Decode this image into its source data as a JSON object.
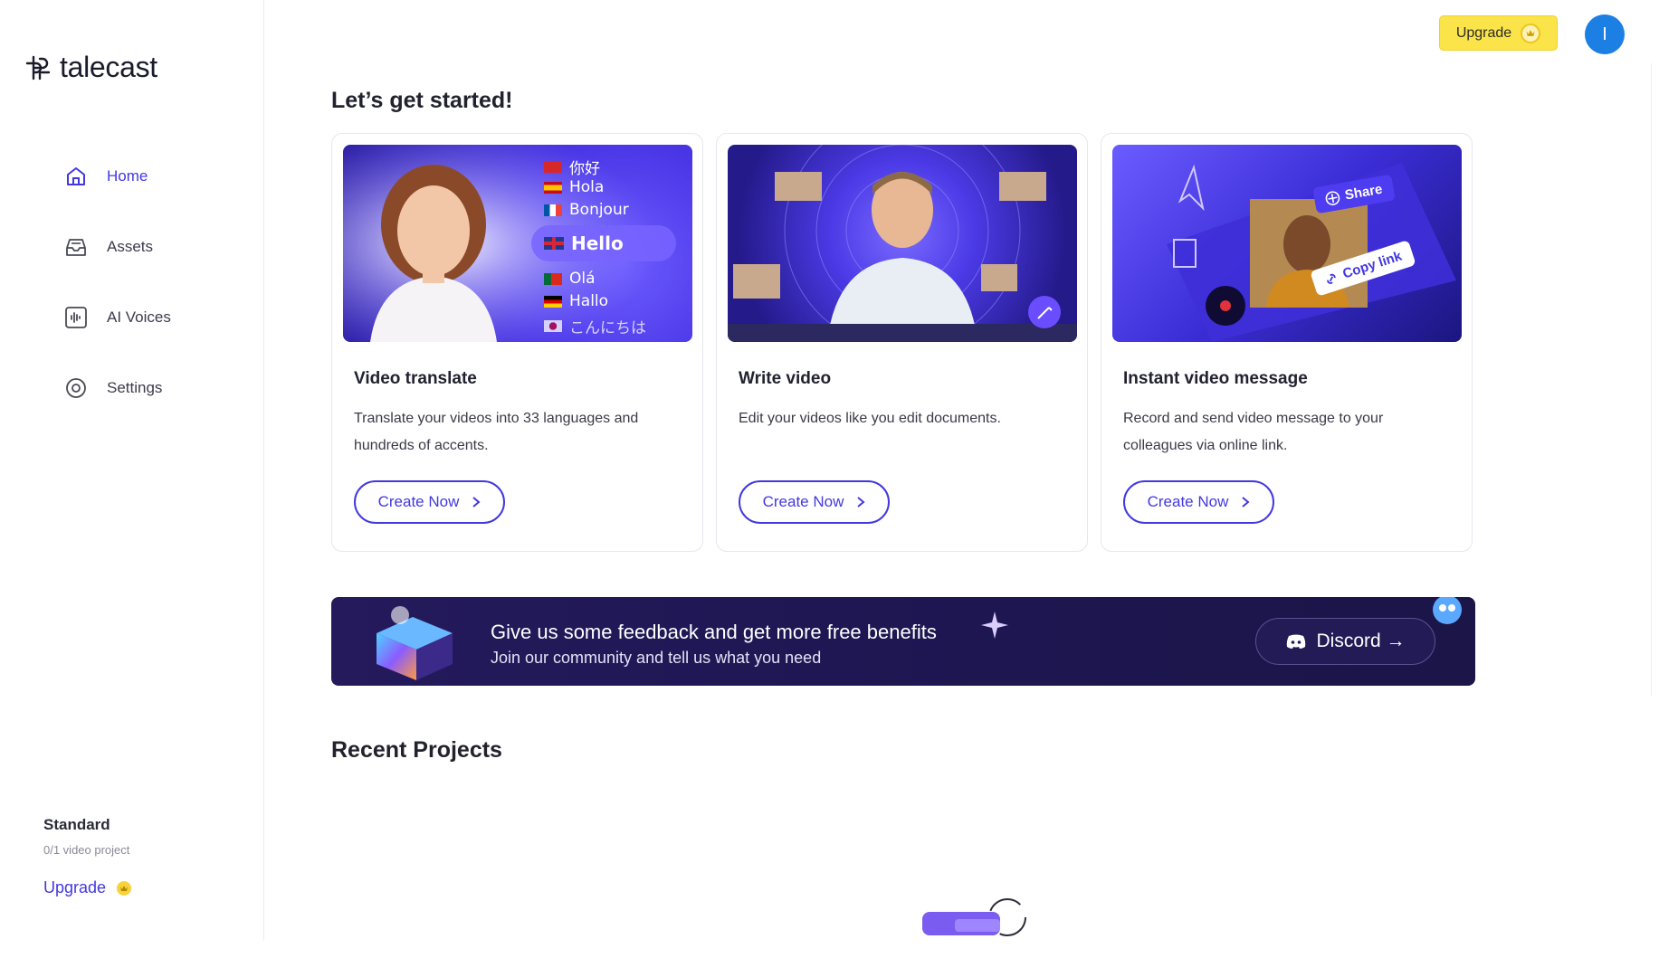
{
  "app": {
    "name": "talecast"
  },
  "sidebar": {
    "items": [
      {
        "label": "Home",
        "icon": "home-icon",
        "active": true
      },
      {
        "label": "Assets",
        "icon": "assets-icon",
        "active": false
      },
      {
        "label": "AI Voices",
        "icon": "waveform-icon",
        "active": false
      },
      {
        "label": "Settings",
        "icon": "gear-icon",
        "active": false
      }
    ],
    "plan": {
      "name": "Standard",
      "usage": "0/1 video project",
      "upgrade_label": "Upgrade"
    }
  },
  "header": {
    "upgrade_label": "Upgrade",
    "avatar_initial": "I"
  },
  "main": {
    "get_started_title": "Let’s get started!",
    "cards": [
      {
        "title": "Video translate",
        "desc": "Translate your videos into 33 languages and hundreds of accents.",
        "button": "Create Now",
        "languages": [
          "你好",
          "Hola",
          "Bonjour",
          "Hello",
          "Olá",
          "Hallo",
          "こんにちは"
        ]
      },
      {
        "title": "Write video",
        "desc": "Edit your videos like you edit documents.",
        "button": "Create Now"
      },
      {
        "title": "Instant video message",
        "desc": "Record and send video message to your colleagues via online link.",
        "button": "Create Now",
        "tags": [
          "Share",
          "Copy link"
        ]
      }
    ],
    "banner": {
      "line1": "Give us some feedback and get more free benefits",
      "line2": "Join our community and tell us what you need",
      "button": "Discord →"
    },
    "recent_title": "Recent Projects"
  },
  "colors": {
    "accent": "#4338e0",
    "upgrade": "#fbe34a",
    "avatar": "#1b7fe3",
    "banner": "#1d1650"
  }
}
